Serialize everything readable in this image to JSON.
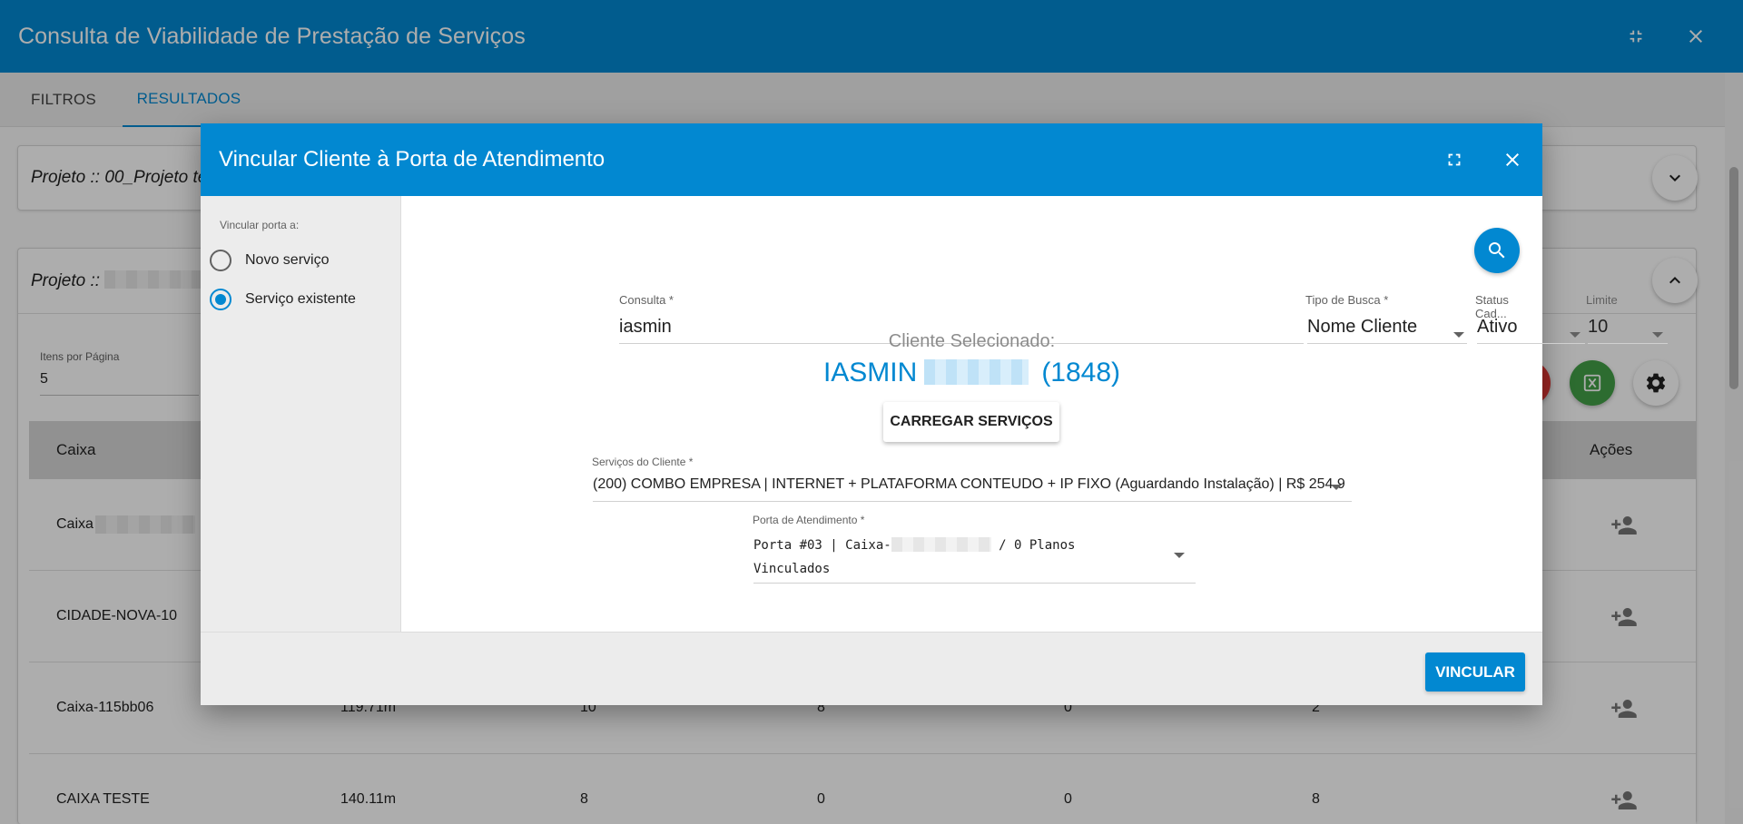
{
  "header": {
    "title": "Consulta de Viabilidade de Prestação de Serviços"
  },
  "tabs": [
    {
      "label": "Filtros"
    },
    {
      "label": "Resultados"
    }
  ],
  "projects": [
    {
      "title": "Projeto :: 00_Projeto te"
    },
    {
      "title": "Projeto :: "
    }
  ],
  "pager": {
    "label": "Itens por Página",
    "value": "5"
  },
  "table": {
    "columns": {
      "caixa": "Caixa",
      "acoes": "Ações"
    },
    "rows": [
      {
        "caixa": "Caixa",
        "c2": "",
        "c3": "",
        "c4": "",
        "c5": "",
        "c6": ""
      },
      {
        "caixa": "CIDADE-NOVA-10",
        "c2": "",
        "c3": "",
        "c4": "",
        "c5": "",
        "c6": ""
      },
      {
        "caixa": "Caixa-115bb06",
        "c2": "119.71m",
        "c3": "10",
        "c4": "8",
        "c5": "0",
        "c6": "2"
      },
      {
        "caixa": "CAIXA TESTE",
        "c2": "140.11m",
        "c3": "8",
        "c4": "0",
        "c5": "0",
        "c6": "8"
      }
    ]
  },
  "dialog": {
    "title": "Vincular Cliente à Porta de Atendimento",
    "side": {
      "label": "Vincular porta a:",
      "options": [
        {
          "label": "Novo serviço",
          "checked": false
        },
        {
          "label": "Serviço existente",
          "checked": true
        }
      ]
    },
    "consulta": {
      "label": "Consulta",
      "value": "iasmin"
    },
    "tipo_busca": {
      "label": "Tipo de Busca",
      "value": "Nome Cliente"
    },
    "status": {
      "label": "Status Cad...",
      "value": "Ativo"
    },
    "limite": {
      "label": "Limite",
      "value": "10"
    },
    "selected": {
      "caption": "Cliente Selecionado:",
      "first_name": "IASMIN",
      "code": "(1848)"
    },
    "load_button": "Carregar Serviços",
    "servicos": {
      "label": "Serviços do Cliente",
      "value": "(200) COMBO EMPRESA | INTERNET + PLATAFORMA CONTEUDO + IP FIXO (Aguardando Instalação) | R$ 254.9"
    },
    "porta": {
      "label": "Porta de Atendimento",
      "line1_prefix": "Porta #03 | Caixa-",
      "line1_suffix": " / 0 Planos",
      "line2": "Vinculados"
    },
    "submit": "Vincular"
  },
  "colors": {
    "primary": "#0288d1",
    "excel": "#43a047",
    "danger": "#e53935"
  },
  "icons": [
    "collapse-icon",
    "close-icon",
    "expand-icon",
    "chevron-down-icon",
    "chevron-up-icon",
    "search-icon",
    "excel-icon",
    "gear-icon",
    "add-user-icon"
  ]
}
